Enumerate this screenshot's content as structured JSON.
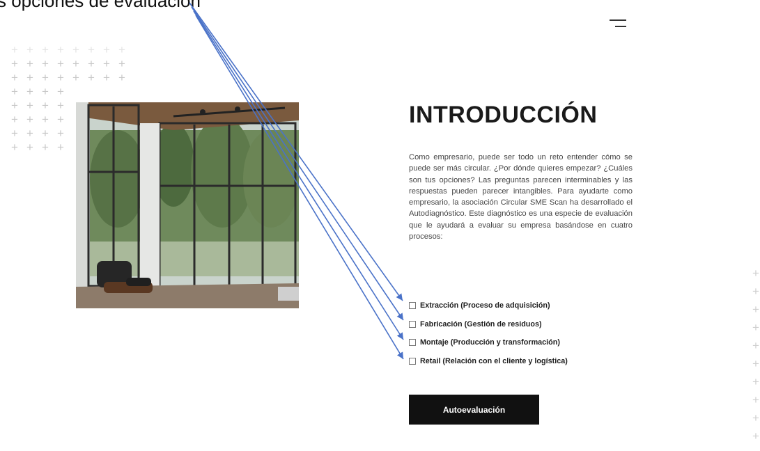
{
  "annotation": {
    "text": "s opciones de evaluación"
  },
  "header": {
    "menu_icon": "hamburger-menu-icon"
  },
  "image": {
    "alt": "Interior moderno con ventanales y bosque"
  },
  "intro": {
    "title": "INTRODUCCIÓN",
    "body": "Como empresario, puede ser todo un reto entender cómo se puede ser más circular. ¿Por dónde quieres empezar? ¿Cuáles son tus opciones? Las preguntas parecen interminables y las respuestas pueden parecer intangibles. Para ayudarte como empresario, la asociación Circular SME Scan ha desarrollado el Autodiagnóstico. Este diagnóstico es una especie de evaluación que le ayudará a evaluar su empresa basándose en cuatro procesos:"
  },
  "processes": [
    {
      "label": "Extracción (Proceso de adquisición)"
    },
    {
      "label": "Fabricación (Gestión de residuos)"
    },
    {
      "label": "Montaje (Producción y transformación)"
    },
    {
      "label": "Retail (Relación con el cliente y logística)"
    }
  ],
  "cta": {
    "label": "Autoevaluación"
  },
  "colors": {
    "arrow": "#4a72c8",
    "button": "#111111"
  }
}
